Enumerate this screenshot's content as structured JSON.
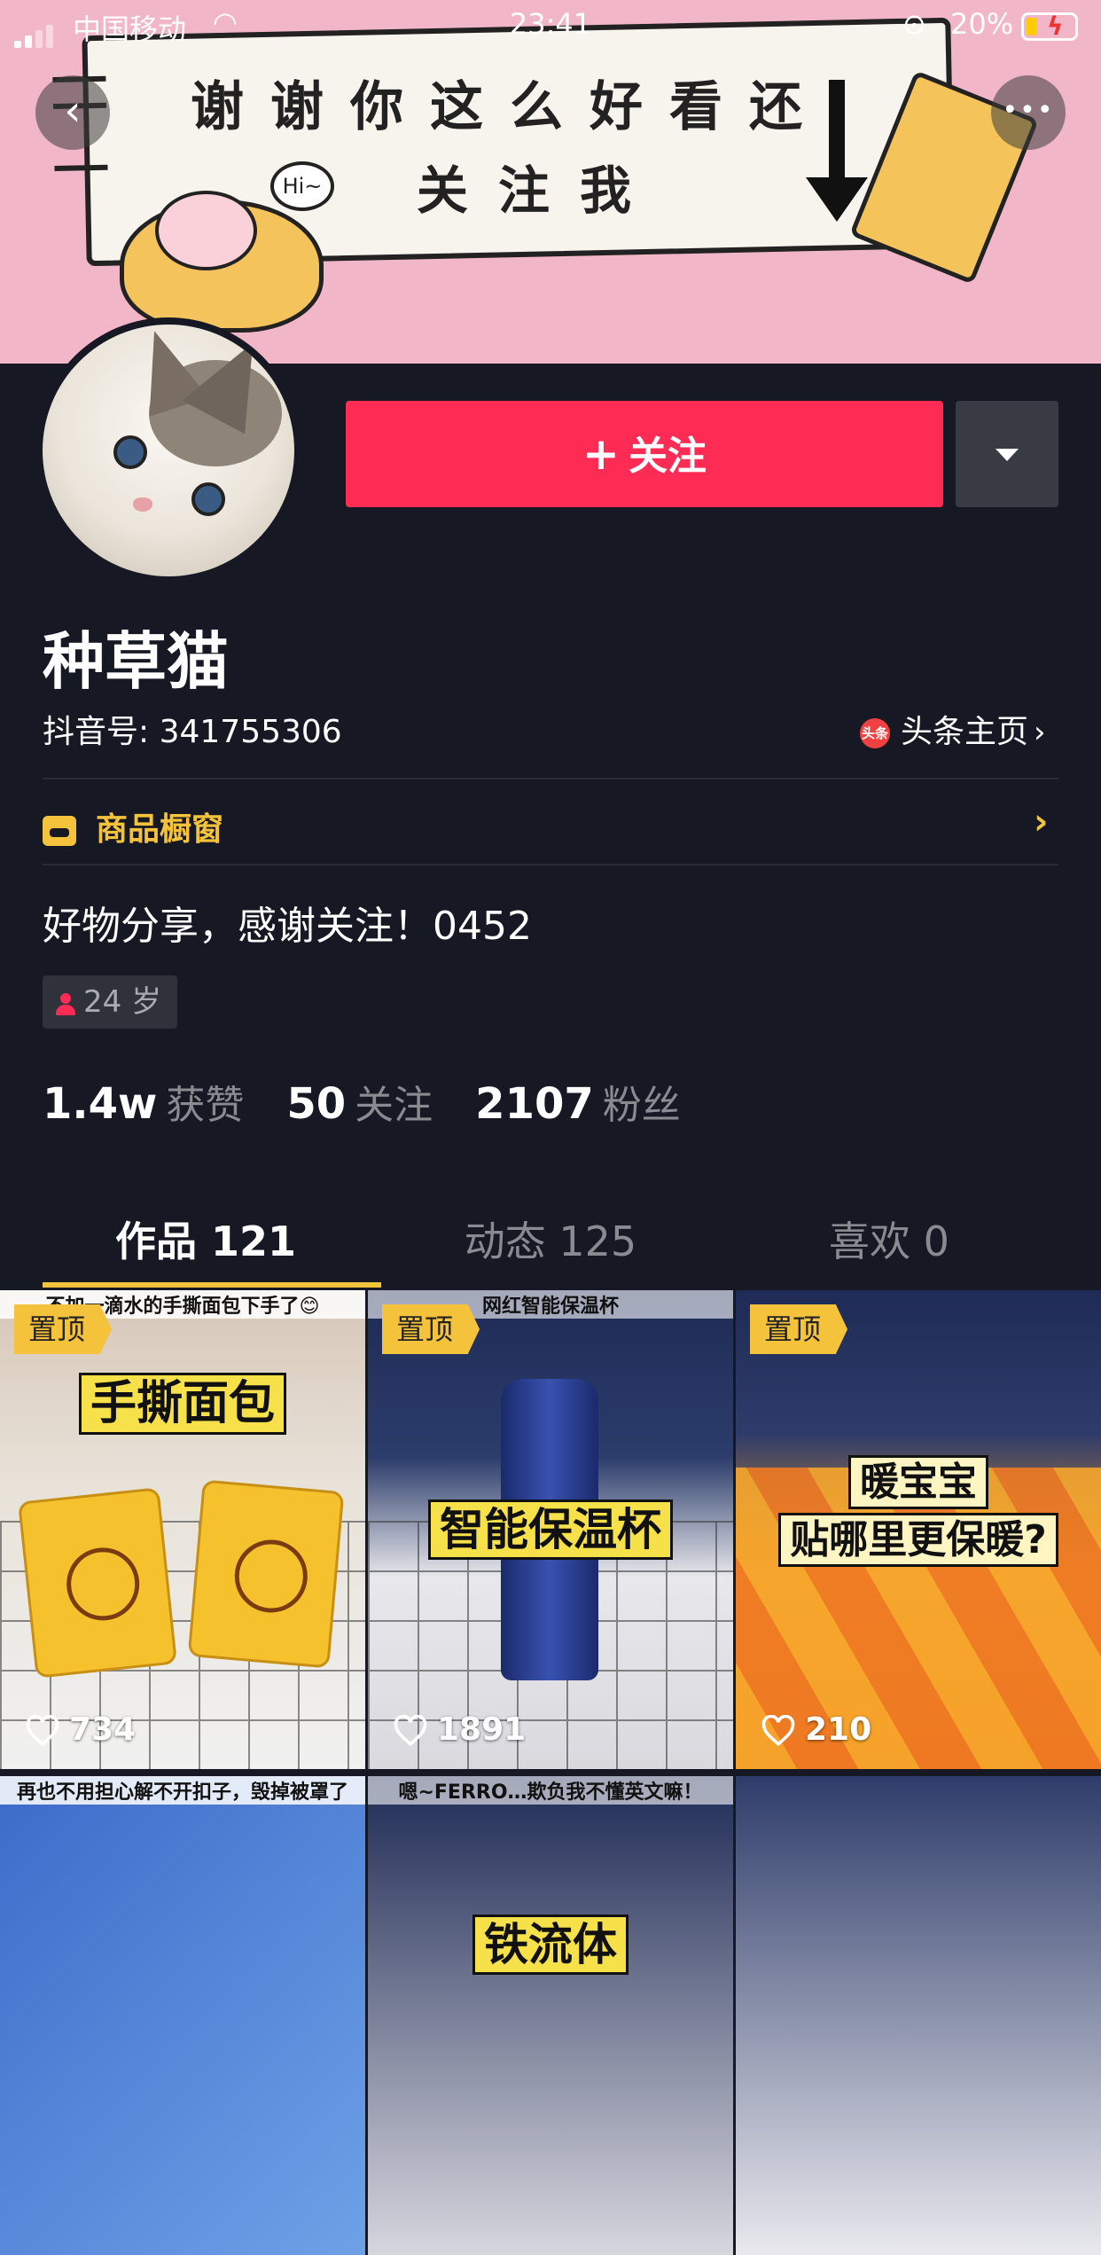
{
  "status_bar": {
    "carrier": "中国移动",
    "time": "23:41",
    "battery": "20%"
  },
  "banner": {
    "line1": "谢谢你这么好看还",
    "line2": "关注我",
    "bubble": "Hi~"
  },
  "actions": {
    "follow_label": "关注",
    "follow_icon": "plus-icon",
    "dropdown_icon": "triangle-down-icon"
  },
  "profile": {
    "nickname": "种草猫",
    "douyin_id": "抖音号: 341755306",
    "toutiao_icon_text": "头条",
    "toutiao_link": "头条主页",
    "shop_label": "商品橱窗",
    "bio": "好物分享，感谢关注！0452",
    "age": "24 岁"
  },
  "stats": [
    {
      "value": "1.4w",
      "label": "获赞"
    },
    {
      "value": "50",
      "label": "关注"
    },
    {
      "value": "2107",
      "label": "粉丝"
    }
  ],
  "tabs": [
    {
      "label": "作品 121"
    },
    {
      "label": "动态 125"
    },
    {
      "label": "喜欢 0"
    }
  ],
  "colors": {
    "accent": "#fe2c55",
    "shop": "#f5c33b",
    "background": "#161823"
  },
  "videos": [
    {
      "pinned": "置顶",
      "top_caption": "不加一滴水的手撕面包下手了😊",
      "title": "手撕面包",
      "likes": "734"
    },
    {
      "pinned": "置顶",
      "top_caption": "网红智能保温杯",
      "title": "智能保温杯",
      "likes": "1891"
    },
    {
      "pinned": "置顶",
      "title_line1": "暖宝宝",
      "title_line2": "贴哪里更保暖?",
      "likes": "210"
    },
    {
      "top_caption": "再也不用担心解不开扣子，毁掉被罩了"
    },
    {
      "top_caption": "嗯~FERRO…欺负我不懂英文嘛！",
      "title": "铁流体"
    },
    {}
  ]
}
